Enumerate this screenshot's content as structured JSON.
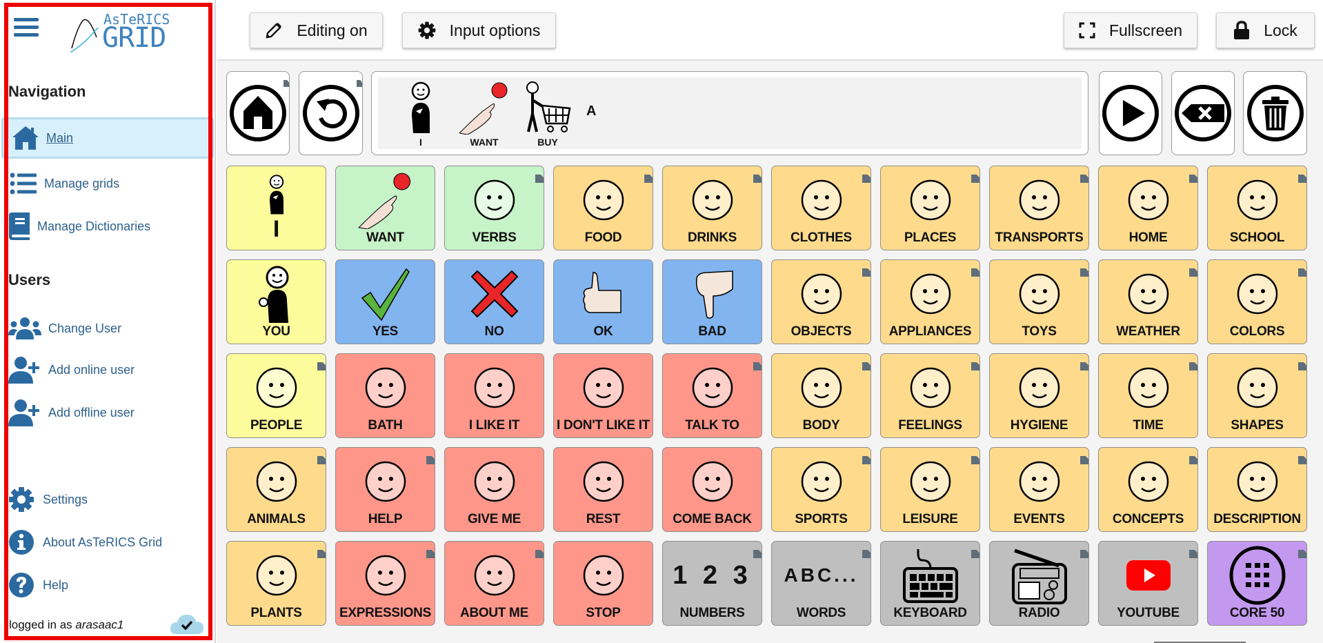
{
  "sidebar": {
    "logo_small": "AsTeRICS",
    "logo_big": "GRID",
    "navigation_title": "Navigation",
    "nav_items": [
      {
        "label": "Main",
        "icon": "home-icon",
        "active": true
      },
      {
        "label": "Manage grids",
        "icon": "list-icon"
      },
      {
        "label": "Manage Dictionaries",
        "icon": "book-icon"
      }
    ],
    "users_title": "Users",
    "user_items": [
      {
        "label": "Change User",
        "icon": "users-icon"
      },
      {
        "label": "Add online user",
        "icon": "user-plus-icon"
      },
      {
        "label": "Add offline user",
        "icon": "user-plus-icon"
      }
    ],
    "bottom_items": [
      {
        "label": "Settings",
        "icon": "gear-icon"
      },
      {
        "label": "About AsTeRICS Grid",
        "icon": "info-icon"
      },
      {
        "label": "Help",
        "icon": "help-icon"
      }
    ],
    "login_prefix": "logged in as",
    "login_user": "arasaac1",
    "sync_status": "synced",
    "highlight_color": "#ee0000"
  },
  "toolbar": {
    "editing_label": "Editing on",
    "input_options_label": "Input options",
    "fullscreen_label": "Fullscreen",
    "lock_label": "Lock"
  },
  "collect": {
    "home_icon": "home-circle-icon",
    "back_icon": "back-circle-icon",
    "words": [
      {
        "label": "I",
        "icon": "pictogram-i"
      },
      {
        "label": "WANT",
        "icon": "pictogram-want"
      },
      {
        "label": "BUY",
        "icon": "pictogram-buy"
      }
    ],
    "typed_text": "A",
    "play_icon": "play-circle-icon",
    "backspace_icon": "backspace-circle-icon",
    "trash_icon": "trash-circle-icon"
  },
  "colors": {
    "yellow": "#fdfc9c",
    "green": "#c7f3c8",
    "orange": "#fedb8c",
    "blue": "#82b4f0",
    "red": "#fe978a",
    "gray": "#bfbfbf",
    "purple": "#c399ef"
  },
  "grid": [
    [
      {
        "label": "I",
        "color": "yellow",
        "icon": "pictogram-i",
        "big_label": true
      },
      {
        "label": "WANT",
        "color": "green",
        "icon": "pictogram-want"
      },
      {
        "label": "VERBS",
        "color": "green",
        "icon": "pictogram-verbs",
        "folder": true
      },
      {
        "label": "FOOD",
        "color": "orange",
        "icon": "pictogram-food",
        "folder": true
      },
      {
        "label": "DRINKS",
        "color": "orange",
        "icon": "pictogram-drinks",
        "folder": true
      },
      {
        "label": "CLOTHES",
        "color": "orange",
        "icon": "pictogram-clothes",
        "folder": true
      },
      {
        "label": "PLACES",
        "color": "orange",
        "icon": "pictogram-places",
        "folder": true
      },
      {
        "label": "TRANSPORTS",
        "color": "orange",
        "icon": "pictogram-transports",
        "folder": true
      },
      {
        "label": "HOME",
        "color": "orange",
        "icon": "pictogram-home",
        "folder": true
      },
      {
        "label": "SCHOOL",
        "color": "orange",
        "icon": "pictogram-school",
        "folder": true
      }
    ],
    [
      {
        "label": "YOU",
        "color": "yellow",
        "icon": "pictogram-you"
      },
      {
        "label": "YES",
        "color": "blue",
        "icon": "pictogram-yes"
      },
      {
        "label": "NO",
        "color": "blue",
        "icon": "pictogram-no"
      },
      {
        "label": "OK",
        "color": "blue",
        "icon": "pictogram-ok"
      },
      {
        "label": "BAD",
        "color": "blue",
        "icon": "pictogram-bad"
      },
      {
        "label": "OBJECTS",
        "color": "orange",
        "icon": "pictogram-objects",
        "folder": true
      },
      {
        "label": "APPLIANCES",
        "color": "orange",
        "icon": "pictogram-appliances",
        "folder": true
      },
      {
        "label": "TOYS",
        "color": "orange",
        "icon": "pictogram-toys",
        "folder": true
      },
      {
        "label": "WEATHER",
        "color": "orange",
        "icon": "pictogram-weather",
        "folder": true
      },
      {
        "label": "COLORS",
        "color": "orange",
        "icon": "pictogram-colors",
        "folder": true
      }
    ],
    [
      {
        "label": "PEOPLE",
        "color": "yellow",
        "icon": "pictogram-people",
        "folder": true
      },
      {
        "label": "BATH",
        "color": "red",
        "icon": "pictogram-bath"
      },
      {
        "label": "I LIKE IT",
        "color": "red",
        "icon": "pictogram-like"
      },
      {
        "label": "I DON'T LIKE IT",
        "color": "red",
        "icon": "pictogram-dislike"
      },
      {
        "label": "TALK TO",
        "color": "red",
        "icon": "pictogram-talk",
        "folder": true
      },
      {
        "label": "BODY",
        "color": "orange",
        "icon": "pictogram-body",
        "folder": true
      },
      {
        "label": "FEELINGS",
        "color": "orange",
        "icon": "pictogram-feelings",
        "folder": true
      },
      {
        "label": "HYGIENE",
        "color": "orange",
        "icon": "pictogram-hygiene",
        "folder": true
      },
      {
        "label": "TIME",
        "color": "orange",
        "icon": "pictogram-time",
        "folder": true
      },
      {
        "label": "SHAPES",
        "color": "orange",
        "icon": "pictogram-shapes",
        "folder": true
      }
    ],
    [
      {
        "label": "ANIMALS",
        "color": "orange",
        "icon": "pictogram-animals",
        "folder": true
      },
      {
        "label": "HELP",
        "color": "red",
        "icon": "pictogram-help",
        "folder": true
      },
      {
        "label": "GIVE ME",
        "color": "red",
        "icon": "pictogram-give-me"
      },
      {
        "label": "REST",
        "color": "red",
        "icon": "pictogram-rest"
      },
      {
        "label": "COME BACK",
        "color": "red",
        "icon": "pictogram-come-back"
      },
      {
        "label": "SPORTS",
        "color": "orange",
        "icon": "pictogram-sports",
        "folder": true
      },
      {
        "label": "LEISURE",
        "color": "orange",
        "icon": "pictogram-leisure",
        "folder": true
      },
      {
        "label": "EVENTS",
        "color": "orange",
        "icon": "pictogram-events",
        "folder": true
      },
      {
        "label": "CONCEPTS",
        "color": "orange",
        "icon": "pictogram-concepts",
        "folder": true
      },
      {
        "label": "DESCRIPTION",
        "color": "orange",
        "icon": "pictogram-description",
        "folder": true
      }
    ],
    [
      {
        "label": "PLANTS",
        "color": "orange",
        "icon": "pictogram-plants",
        "folder": true
      },
      {
        "label": "EXPRESSIONS",
        "color": "red",
        "icon": "pictogram-expressions",
        "folder": true
      },
      {
        "label": "ABOUT ME",
        "color": "red",
        "icon": "pictogram-about-me",
        "folder": true
      },
      {
        "label": "STOP",
        "color": "red",
        "icon": "pictogram-stop"
      },
      {
        "label": "NUMBERS",
        "color": "gray",
        "icon": "pictogram-numbers",
        "folder": true,
        "pic_text": "1 2 3"
      },
      {
        "label": "WORDS",
        "color": "gray",
        "icon": "pictogram-words",
        "folder": true,
        "pic_text": "ABC..."
      },
      {
        "label": "KEYBOARD",
        "color": "gray",
        "icon": "pictogram-keyboard",
        "folder": true
      },
      {
        "label": "RADIO",
        "color": "gray",
        "icon": "pictogram-radio",
        "folder": true
      },
      {
        "label": "YOUTUBE",
        "color": "gray",
        "icon": "pictogram-youtube",
        "folder": true
      },
      {
        "label": "CORE 50",
        "color": "purple",
        "icon": "pictogram-core50",
        "folder": true
      }
    ]
  ]
}
